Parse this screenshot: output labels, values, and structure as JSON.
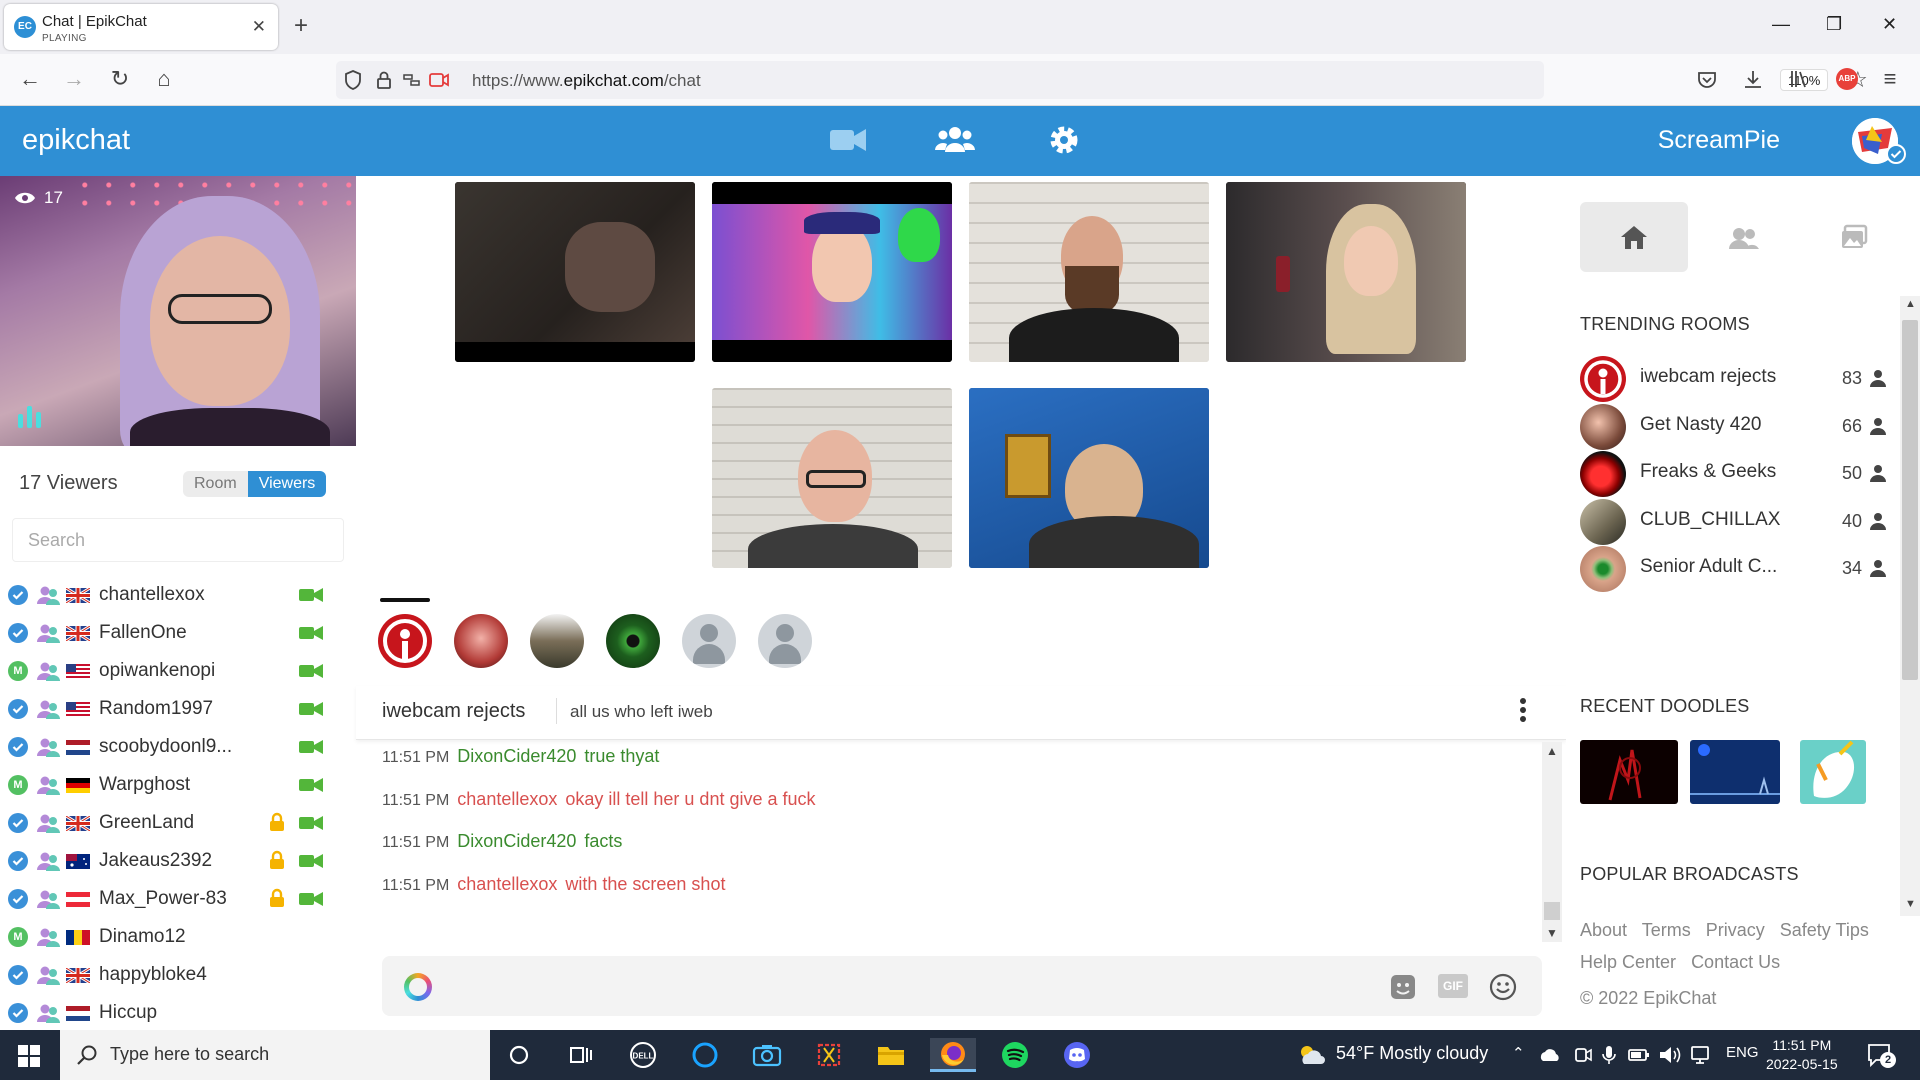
{
  "browser": {
    "tab_title": "Chat | EpikChat",
    "tab_subtitle": "PLAYING",
    "tab_favicon_text": "EC",
    "url_prefix": "https://www.",
    "url_domain": "epikchat.com",
    "url_path": "/chat",
    "zoom": "110%",
    "abp_label": "ABP"
  },
  "app": {
    "logo": "epikchat",
    "username": "ScreamPie",
    "accent_color": "#2f8fd4"
  },
  "my_cam": {
    "viewer_count": "17"
  },
  "viewers_panel": {
    "title": "17 Viewers",
    "tab_room": "Room",
    "tab_viewers": "Viewers",
    "search_placeholder": "Search",
    "items": [
      {
        "name": "chantellexox",
        "badge": "check",
        "flag": "uk",
        "locked": false,
        "cam": true
      },
      {
        "name": "FallenOne",
        "badge": "check",
        "flag": "uk",
        "locked": false,
        "cam": true
      },
      {
        "name": "opiwankenopi",
        "badge": "M",
        "flag": "us",
        "locked": false,
        "cam": true
      },
      {
        "name": "Random1997",
        "badge": "check",
        "flag": "us",
        "locked": false,
        "cam": true
      },
      {
        "name": "scoobydoonl9...",
        "badge": "check",
        "flag": "nl",
        "locked": false,
        "cam": true
      },
      {
        "name": "Warpghost",
        "badge": "M",
        "flag": "de",
        "locked": false,
        "cam": true
      },
      {
        "name": "GreenLand",
        "badge": "check",
        "flag": "uk",
        "locked": true,
        "cam": true
      },
      {
        "name": "Jakeaus2392",
        "badge": "check",
        "flag": "au",
        "locked": true,
        "cam": true
      },
      {
        "name": "Max_Power-83",
        "badge": "check",
        "flag": "at",
        "locked": true,
        "cam": true
      },
      {
        "name": "Dinamo12",
        "badge": "M",
        "flag": "ro",
        "locked": false,
        "cam": false
      },
      {
        "name": "happybloke4",
        "badge": "check",
        "flag": "uk",
        "locked": false,
        "cam": false
      },
      {
        "name": "Hiccup",
        "badge": "check",
        "flag": "nl",
        "locked": false,
        "cam": false
      }
    ]
  },
  "room": {
    "name": "iwebcam rejects",
    "description": "all us who left iweb"
  },
  "chat": {
    "messages": [
      {
        "time": "11:51 PM",
        "nick": "DixonCider420",
        "text": "true thyat",
        "color": "green"
      },
      {
        "time": "11:51 PM",
        "nick": "chantellexox",
        "text": "okay ill tell her u dnt give a fuck",
        "color": "red"
      },
      {
        "time": "11:51 PM",
        "nick": "DixonCider420",
        "text": "facts",
        "color": "green"
      },
      {
        "time": "11:51 PM",
        "nick": "chantellexox",
        "text": "with the screen shot",
        "color": "red"
      }
    ],
    "gif_label": "GIF"
  },
  "sidebar": {
    "trending_title": "TRENDING ROOMS",
    "trending": [
      {
        "name": "iwebcam rejects",
        "count": "83"
      },
      {
        "name": "Get Nasty 420",
        "count": "66"
      },
      {
        "name": "Freaks & Geeks",
        "count": "50"
      },
      {
        "name": "CLUB_CHILLAX",
        "count": "40"
      },
      {
        "name": "Senior Adult C...",
        "count": "34"
      }
    ],
    "doodles_title": "RECENT DOODLES",
    "broadcasts_title": "POPULAR BROADCASTS",
    "links": {
      "about": "About",
      "terms": "Terms",
      "privacy": "Privacy",
      "safety": "Safety Tips",
      "help": "Help Center",
      "contact": "Contact Us"
    },
    "copyright": "© 2022 EpikChat"
  },
  "taskbar": {
    "search_placeholder": "Type here to search",
    "weather": "54°F  Mostly cloudy",
    "lang": "ENG",
    "time": "11:51 PM",
    "date": "2022-05-15",
    "notification_count": "2"
  }
}
